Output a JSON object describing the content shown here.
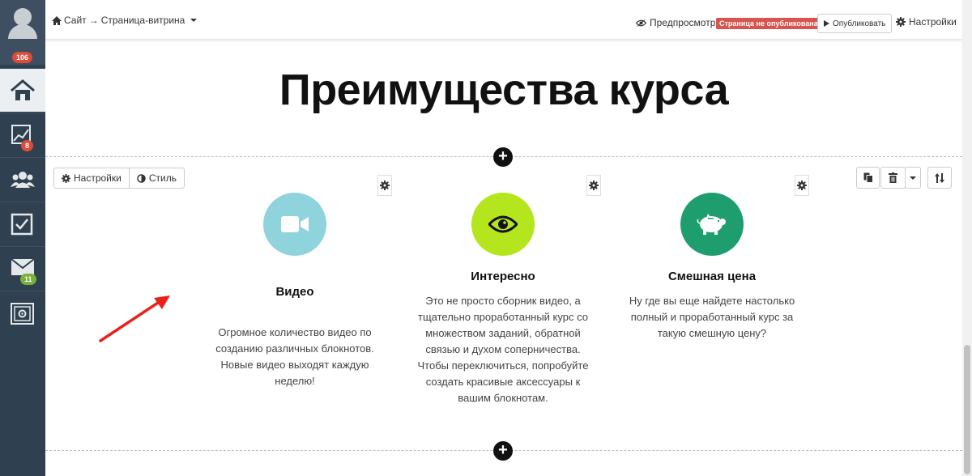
{
  "sidebar": {
    "avatar_badge": "106",
    "items": [
      {
        "icon": "home-icon",
        "badge": ""
      },
      {
        "icon": "chart-icon",
        "badge": "8"
      },
      {
        "icon": "users-icon",
        "badge": ""
      },
      {
        "icon": "checkbox-icon",
        "badge": ""
      },
      {
        "icon": "mail-icon",
        "badge": "11"
      },
      {
        "icon": "safe-icon",
        "badge": ""
      }
    ]
  },
  "topbar": {
    "breadcrumb_site": "Сайт",
    "breadcrumb_arrow": "→",
    "breadcrumb_page": "Страница-витрина",
    "preview_label": "Предпросмотр",
    "status_badge": "Страница не опубликована",
    "publish_label": "Опубликовать",
    "settings_label": "Настройки"
  },
  "page": {
    "heading": "Преимущества курса"
  },
  "block_toolbar": {
    "settings_label": "Настройки",
    "style_label": "Стиль"
  },
  "features": [
    {
      "title": "Видео",
      "text": "Огромное количество видео по созданию различных блокнотов. Новые видео выходят каждую неделю!",
      "color": "#8fd3dc",
      "icon": "video-camera-icon"
    },
    {
      "title": "Интересно",
      "text": "Это не просто сборник видео, а тщательно проработанный курс со множеством заданий, обратной связью и духом соперничества. Чтобы переключиться, попробуйте создать красивые аксессуары к вашим блокнотам.",
      "color": "#b5e61d",
      "icon": "eye-icon"
    },
    {
      "title": "Смешная цена",
      "text": "Ну где вы еще найдете настолько полный и проработанный курс за такую смешную цену?",
      "color": "#1e9e6e",
      "icon": "piggy-bank-icon"
    }
  ],
  "colors": {
    "sidebar_bg": "#2f4050",
    "badge_red": "#dd4b39",
    "badge_green": "#7cae3b",
    "status_red": "#d9534f",
    "annotation_arrow": "#e8221b"
  }
}
